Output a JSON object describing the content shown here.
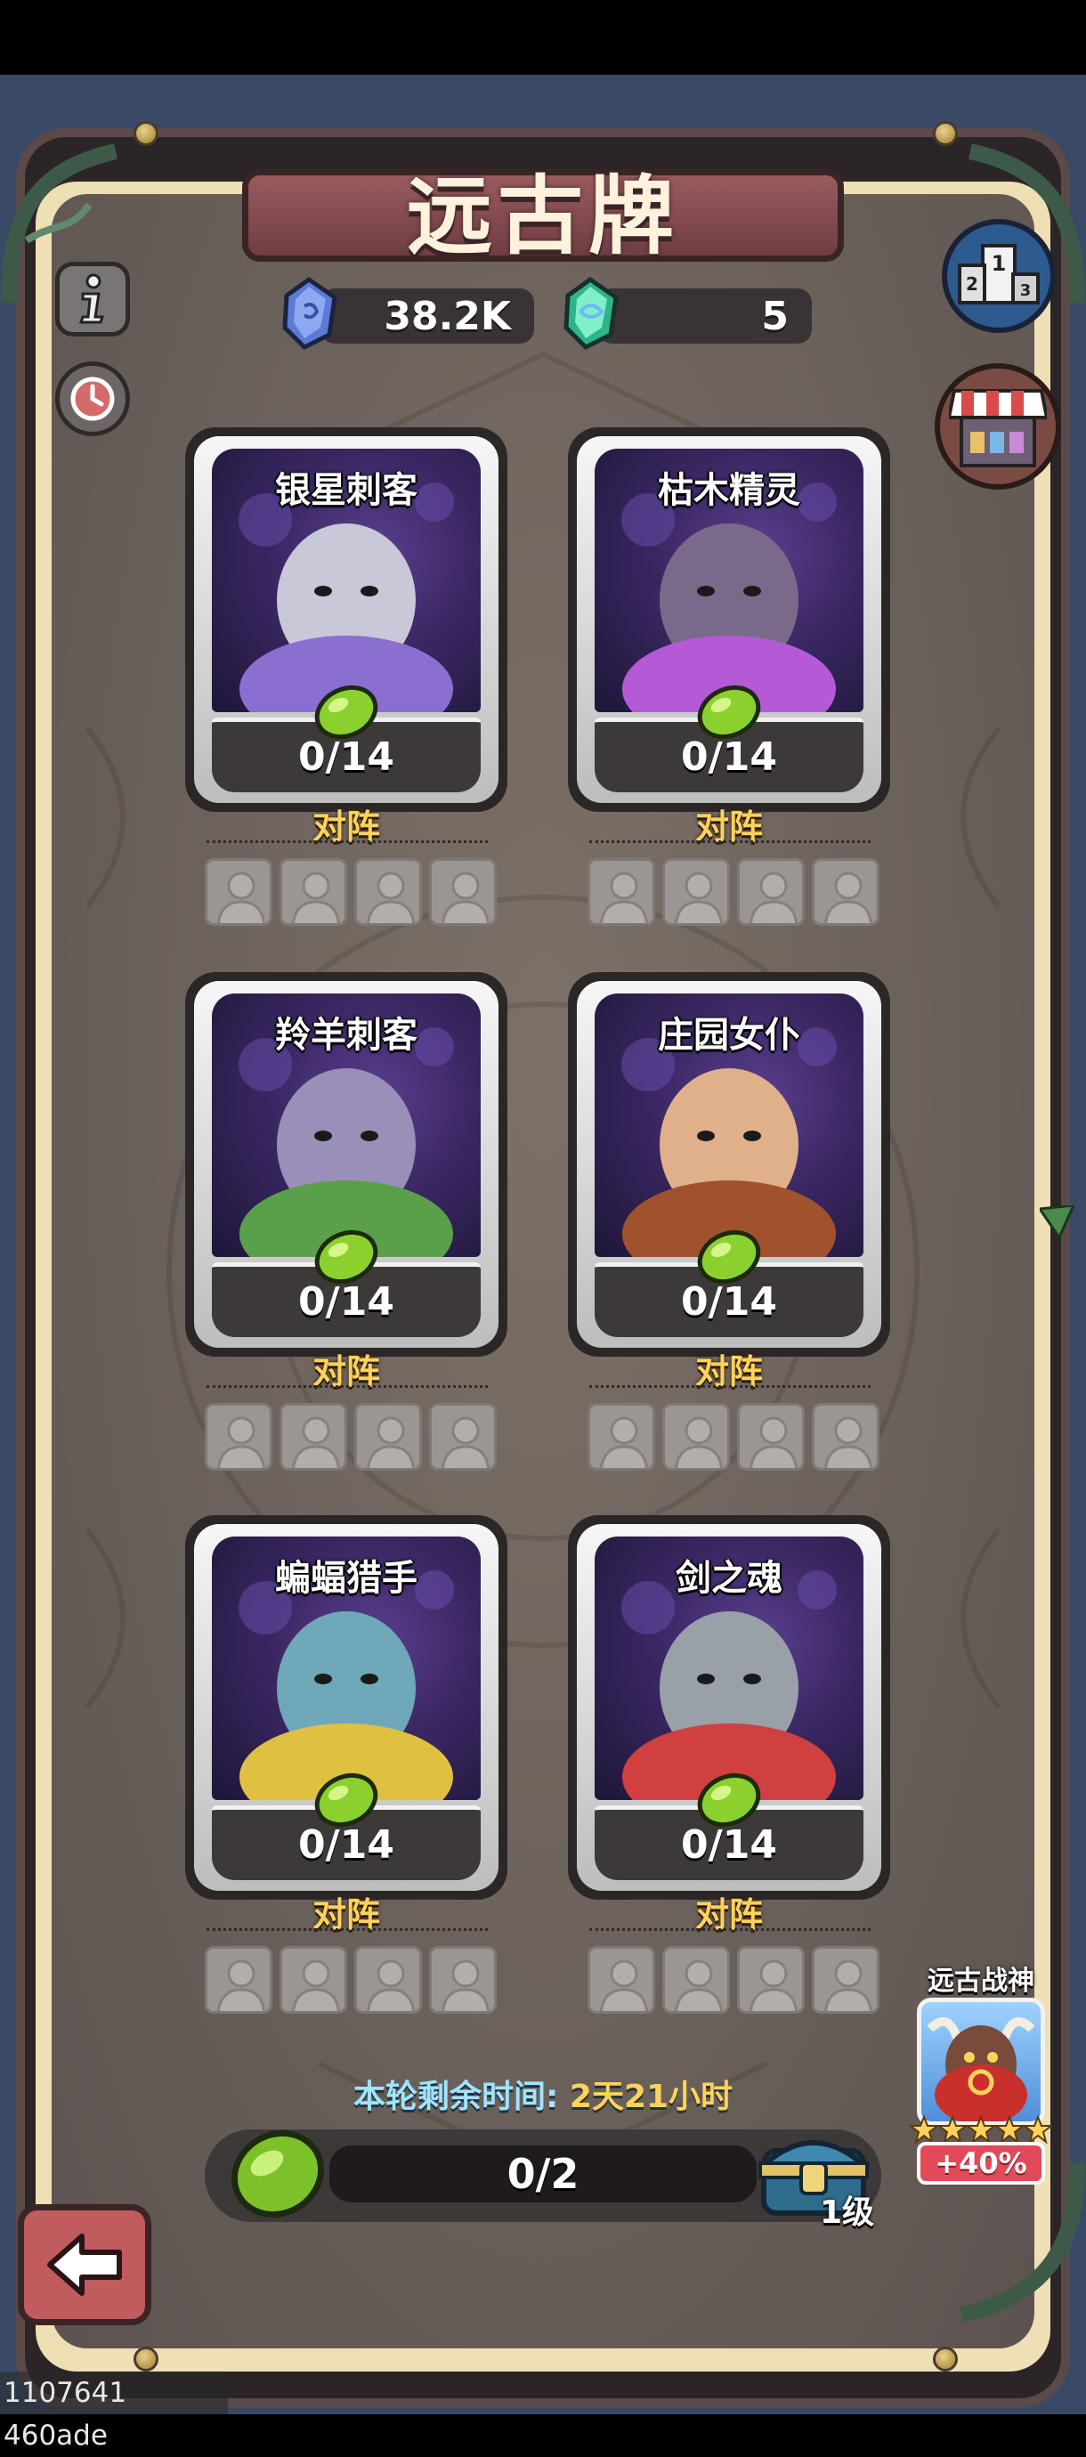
{
  "header": {
    "title": "远古牌"
  },
  "currencies": [
    {
      "name": "blue-crystal",
      "value": "38.2K",
      "color": "#5b7bd6"
    },
    {
      "name": "green-crystal",
      "value": "5",
      "color": "#3fd1a3"
    }
  ],
  "side_buttons": {
    "info_icon": "info-icon",
    "history_icon": "history-icon",
    "ranking_icon": "ranking-podium-icon",
    "shop_icon": "shop-awning-icon"
  },
  "cards": [
    {
      "name": "银星刺客",
      "progress": "0/14",
      "duel": "对阵",
      "art": "silver-haired-assassin"
    },
    {
      "name": "枯木精灵",
      "progress": "0/14",
      "duel": "对阵",
      "art": "withered-wood-spirit"
    },
    {
      "name": "羚羊刺客",
      "progress": "0/14",
      "duel": "对阵",
      "art": "antelope-assassin"
    },
    {
      "name": "庄园女仆",
      "progress": "0/14",
      "duel": "对阵",
      "art": "manor-maid"
    },
    {
      "name": "蝙蝠猎手",
      "progress": "0/14",
      "duel": "对阵",
      "art": "bat-hunter"
    },
    {
      "name": "剑之魂",
      "progress": "0/14",
      "duel": "对阵",
      "art": "sword-soul"
    }
  ],
  "footer": {
    "timer_label": "本轮剩余时间: ",
    "timer_value": "2天21小时",
    "progress_text": "0/2",
    "progress_fraction": 0,
    "chest_level": "1级",
    "god_title": "远古战神",
    "god_stars": 5,
    "god_bonus": "+40%"
  },
  "watermark": "1107641 460ade"
}
